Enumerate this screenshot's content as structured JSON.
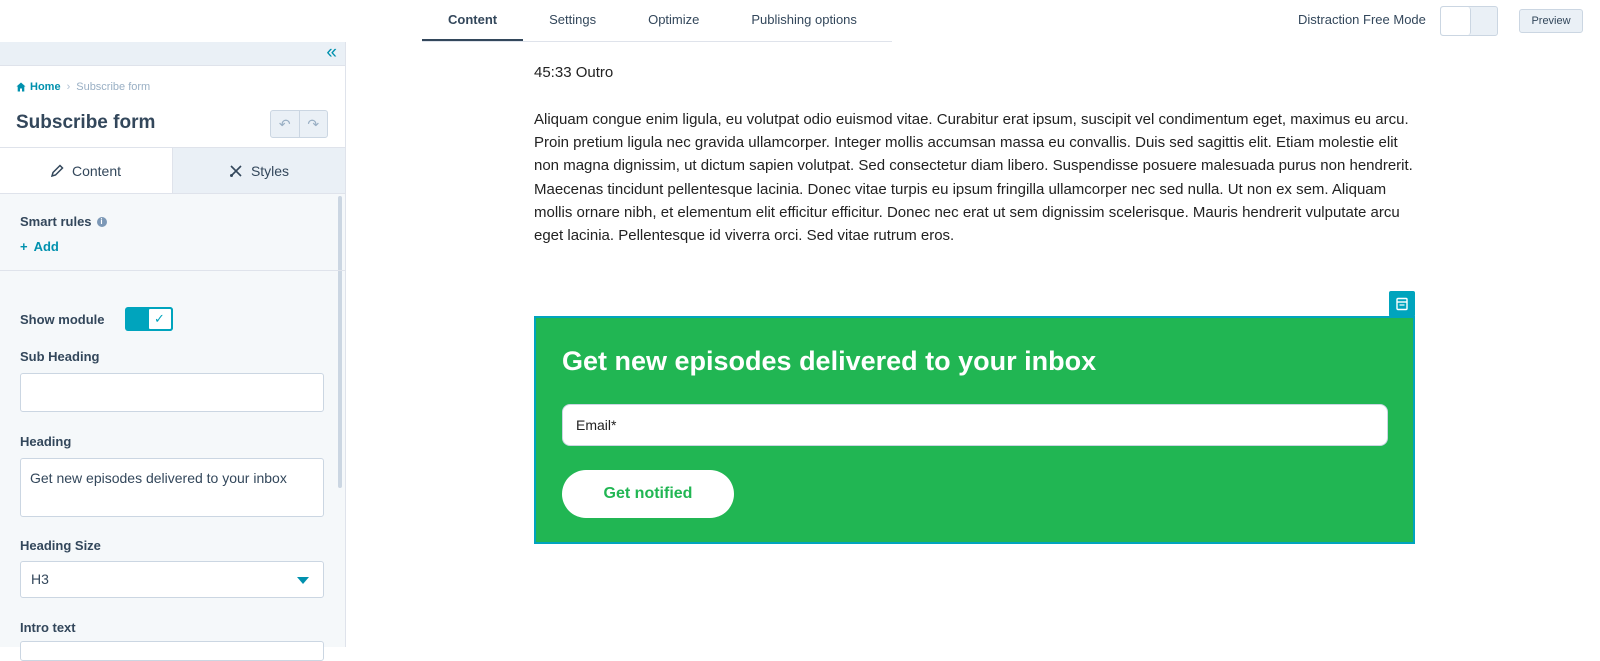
{
  "topbar": {
    "tabs": [
      {
        "label": "Content",
        "active": true
      },
      {
        "label": "Settings",
        "active": false
      },
      {
        "label": "Optimize",
        "active": false
      },
      {
        "label": "Publishing options",
        "active": false
      }
    ],
    "distraction_free_label": "Distraction Free Mode",
    "distraction_free_on": false,
    "preview_label": "Preview"
  },
  "sidebar": {
    "collapse_icon": "double-chevron-left-icon",
    "breadcrumb": {
      "home": "Home",
      "current": "Subscribe form"
    },
    "title": "Subscribe form",
    "tabs": [
      {
        "label": "Content",
        "icon": "pencil-icon",
        "active": true
      },
      {
        "label": "Styles",
        "icon": "styles-icon",
        "active": false
      }
    ],
    "smart_rules": {
      "label": "Smart rules",
      "add_label": "Add"
    },
    "show_module": {
      "label": "Show module",
      "on": true
    },
    "sub_heading": {
      "label": "Sub Heading",
      "value": ""
    },
    "heading": {
      "label": "Heading",
      "value": "Get new episodes delivered to your inbox"
    },
    "heading_size": {
      "label": "Heading Size",
      "value": "H3"
    },
    "intro_text": {
      "label": "Intro text"
    }
  },
  "main": {
    "outro": "45:33 Outro",
    "paragraph": "Aliquam congue enim ligula, eu volutpat odio euismod vitae. Curabitur erat ipsum, suscipit vel condimentum eget, maximus eu arcu. Proin pretium ligula nec gravida ullamcorper. Integer mollis accumsan massa eu convallis. Duis sed sagittis elit. Etiam molestie elit non magna dignissim, ut dictum sapien volutpat. Sed consectetur diam libero. Suspendisse posuere malesuada purus non hendrerit. Maecenas tincidunt pellentesque lacinia. Donec vitae turpis eu ipsum fringilla ullamcorper nec sed nulla. Ut non ex sem. Aliquam mollis ornare nibh, et elementum elit efficitur efficitur. Donec nec erat ut sem dignissim scelerisque. Mauris hendrerit vulputate arcu eget lacinia. Pellentesque id viverra orci. Sed vitae rutrum eros.",
    "subscribe": {
      "heading": "Get new episodes delivered to your inbox",
      "email_placeholder": "Email*",
      "button_label": "Get notified",
      "background_color": "#21b653",
      "selection_color": "#00a4bd"
    }
  },
  "colors": {
    "accent": "#00a4bd",
    "link": "#0091ae",
    "text": "#33475b"
  }
}
